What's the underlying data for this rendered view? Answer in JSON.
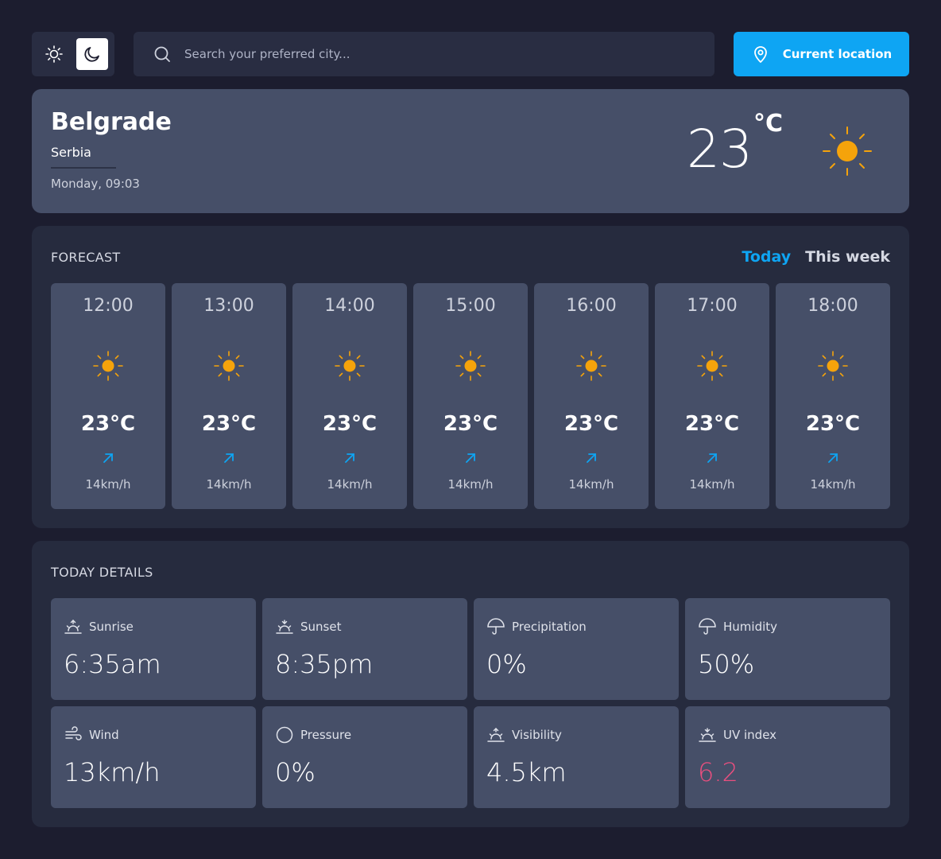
{
  "theme_toggle": {
    "light_icon": "sun-icon",
    "dark_icon": "moon-icon",
    "selected": "dark"
  },
  "search": {
    "placeholder": "Search your preferred city...",
    "value": ""
  },
  "location_button": {
    "label": "Current location",
    "icon": "map-pin-icon"
  },
  "accent_color": "#0ea5f3",
  "sun_color": "#f5a30b",
  "current": {
    "city": "Belgrade",
    "country": "Serbia",
    "datetime": "Monday, 09:03",
    "temperature": "23",
    "unit": "°C",
    "icon": "sun-icon"
  },
  "forecast": {
    "title": "FORECAST",
    "tabs": [
      {
        "label": "Today",
        "active": true
      },
      {
        "label": "This week",
        "active": false
      }
    ],
    "hours": [
      {
        "time": "12:00",
        "temp": "23°C",
        "wind": "14km/h",
        "icon": "sun-icon"
      },
      {
        "time": "13:00",
        "temp": "23°C",
        "wind": "14km/h",
        "icon": "sun-icon"
      },
      {
        "time": "14:00",
        "temp": "23°C",
        "wind": "14km/h",
        "icon": "sun-icon"
      },
      {
        "time": "15:00",
        "temp": "23°C",
        "wind": "14km/h",
        "icon": "sun-icon"
      },
      {
        "time": "16:00",
        "temp": "23°C",
        "wind": "14km/h",
        "icon": "sun-icon"
      },
      {
        "time": "17:00",
        "temp": "23°C",
        "wind": "14km/h",
        "icon": "sun-icon"
      },
      {
        "time": "18:00",
        "temp": "23°C",
        "wind": "14km/h",
        "icon": "sun-icon"
      }
    ]
  },
  "details": {
    "title": "TODAY DETAILS",
    "items": [
      {
        "label": "Sunrise",
        "value": "6:35am",
        "icon": "sunrise-icon"
      },
      {
        "label": "Sunset",
        "value": "8:35pm",
        "icon": "sunset-icon"
      },
      {
        "label": "Precipitation",
        "value": "0%",
        "icon": "umbrella-icon"
      },
      {
        "label": "Humidity",
        "value": "50%",
        "icon": "umbrella-icon"
      },
      {
        "label": "Wind",
        "value": "13km/h",
        "icon": "wind-icon"
      },
      {
        "label": "Pressure",
        "value": "0%",
        "icon": "circle-icon"
      },
      {
        "label": "Visibility",
        "value": "4.5km",
        "icon": "sunrise-icon"
      },
      {
        "label": "UV index",
        "value": "6.2",
        "icon": "sunset-icon",
        "value_color": "#e94f7f"
      }
    ]
  }
}
